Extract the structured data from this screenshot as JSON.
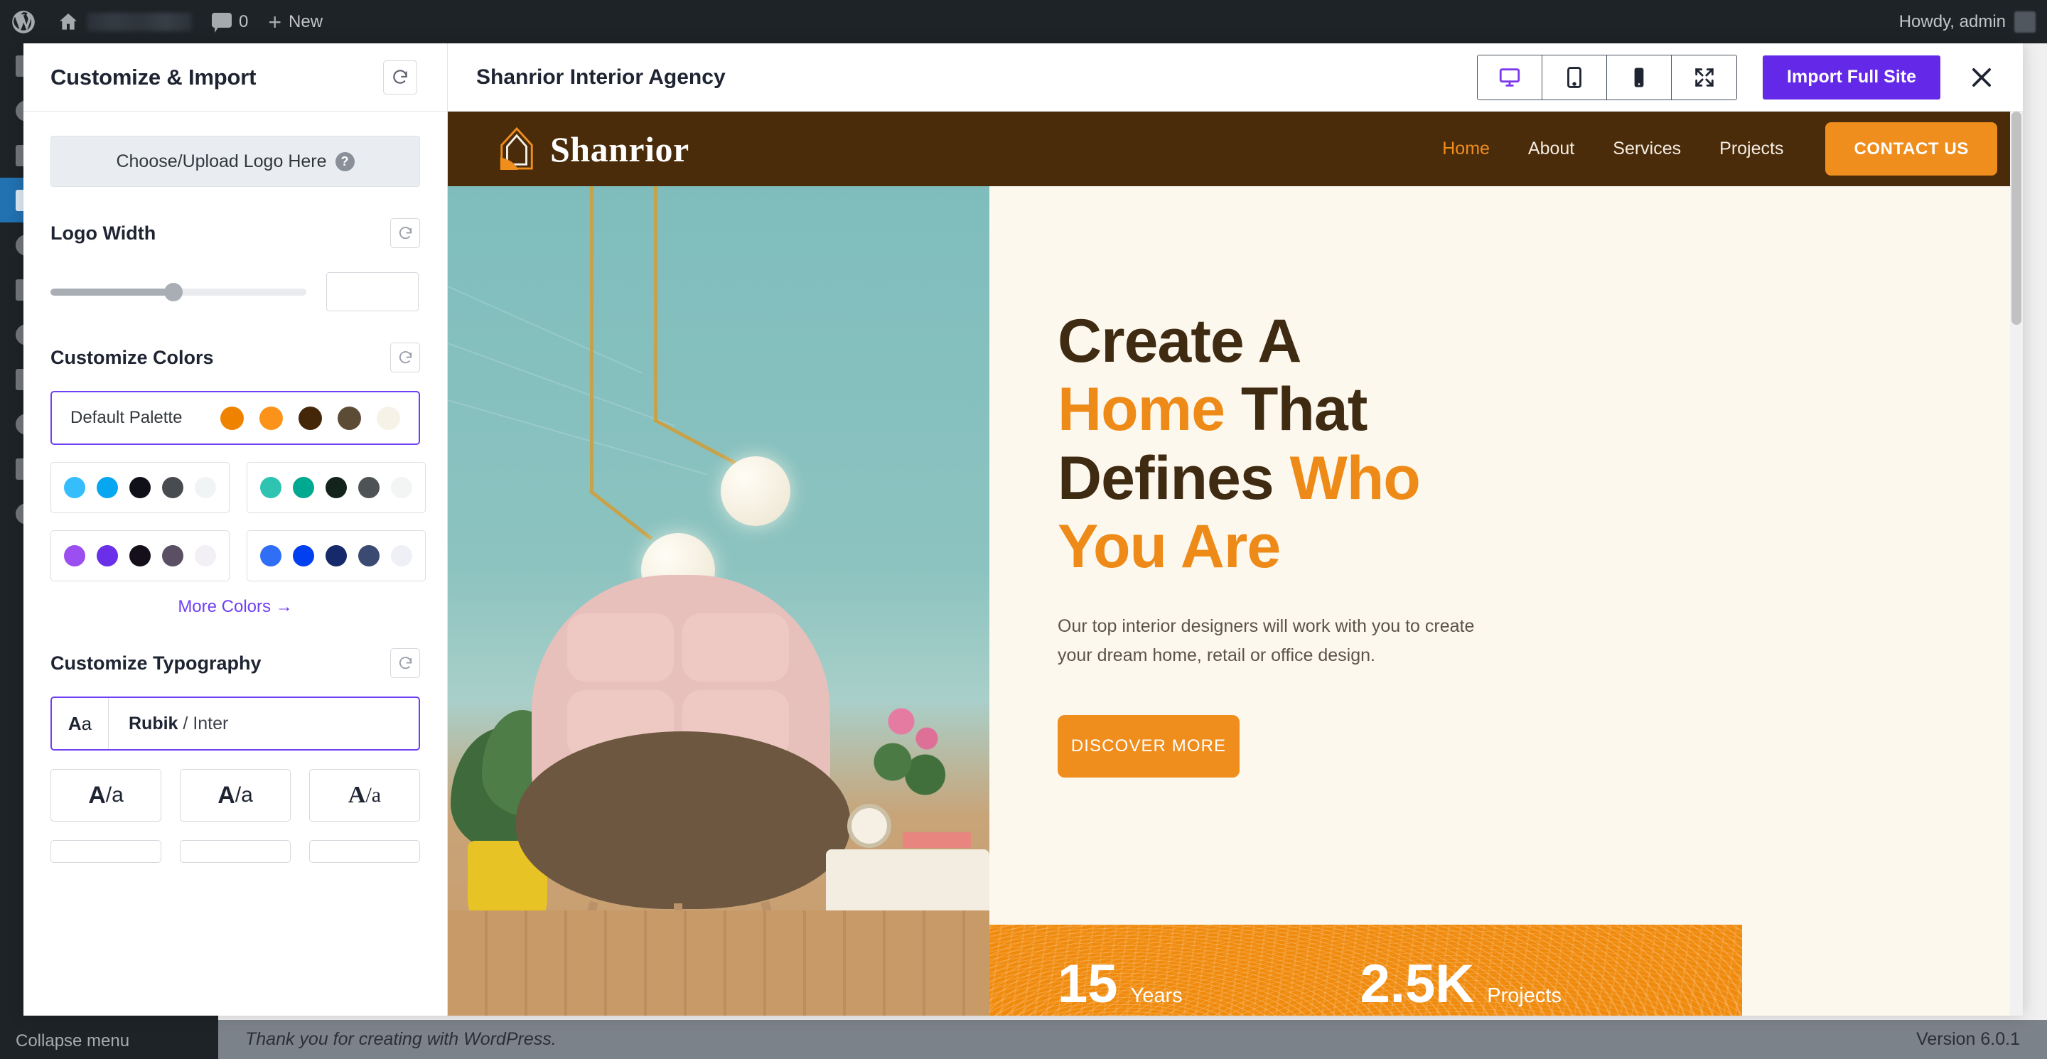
{
  "adminbar": {
    "wp_logo_icon": "wordpress-logo-icon",
    "home_icon": "home-icon",
    "site_name": "",
    "comment_icon": "comment-bubble-icon",
    "comment_count": "0",
    "new_icon": "plus-icon",
    "new_label": "New",
    "howdy": "Howdy, admin",
    "avatar": "avatar"
  },
  "admin_menu": {
    "collapse_label": "Collapse menu"
  },
  "footer": {
    "thanks": "Thank you for creating with WordPress.",
    "version": "Version 6.0.1"
  },
  "panel": {
    "title": "Customize & Import",
    "reset_icon": "reset-icon",
    "logo": {
      "upload_label": "Choose/Upload Logo Here",
      "help_icon": "help-icon",
      "help_glyph": "?"
    },
    "logo_width": {
      "title": "Logo Width",
      "value": "",
      "placeholder": "",
      "percent": 48
    },
    "colors": {
      "title": "Customize Colors",
      "more_label": "More Colors",
      "more_arrow": "→",
      "palettes": [
        {
          "name": "Default Palette",
          "selected": true,
          "swatches": [
            "#ef8300",
            "#fb9219",
            "#432708",
            "#5c4c35",
            "#f7f2e8"
          ]
        },
        {
          "name": "",
          "selected": false,
          "swatches": [
            "#35befb",
            "#07a6f0",
            "#101018",
            "#484c51",
            "#f1f4f5"
          ]
        },
        {
          "name": "",
          "selected": false,
          "swatches": [
            "#2fc4b2",
            "#00a98f",
            "#13241d",
            "#4e5356",
            "#f2f5f3"
          ]
        },
        {
          "name": "",
          "selected": false,
          "swatches": [
            "#9b4ff0",
            "#6a2fe8",
            "#150f1c",
            "#5a4f63",
            "#f2eff5"
          ]
        },
        {
          "name": "",
          "selected": false,
          "swatches": [
            "#2f6ef5",
            "#0040f0",
            "#16296b",
            "#3a4a70",
            "#eef0f5"
          ]
        }
      ]
    },
    "typography": {
      "title": "Customize Typography",
      "sample_caps": "A",
      "sample_lower": "a",
      "selected": {
        "heading_font": "Rubik",
        "separator": "/",
        "body_font": "Inter"
      },
      "tiles": [
        {
          "caps": "A",
          "slash": "/",
          "lower": "a"
        },
        {
          "caps": "A",
          "slash": "/",
          "lower": "a"
        },
        {
          "caps": "A",
          "slash": "/",
          "lower": "a"
        }
      ]
    }
  },
  "preview": {
    "title": "Shanrior Interior Agency",
    "devices": [
      {
        "name": "desktop",
        "icon": "desktop-icon",
        "active": true
      },
      {
        "name": "tablet",
        "icon": "tablet-icon",
        "active": false
      },
      {
        "name": "mobile",
        "icon": "mobile-icon",
        "active": false
      },
      {
        "name": "fullscreen",
        "icon": "expand-icon",
        "active": false
      }
    ],
    "import_label": "Import Full Site",
    "close_icon": "close-icon",
    "accent_color": "#6429e8"
  },
  "site": {
    "brand": {
      "name": "Shanrior",
      "logo_icon": "shanrior-logo-icon"
    },
    "nav": [
      {
        "label": "Home",
        "active": true
      },
      {
        "label": "About",
        "active": false
      },
      {
        "label": "Services",
        "active": false
      },
      {
        "label": "Projects",
        "active": false
      }
    ],
    "cta": "CONTACT US",
    "hero": {
      "line1": "Create A",
      "line2_accent": "Home",
      "line2_rest": "That",
      "line3_rest": "Defines",
      "line3_accent": "Who",
      "line4_accent": "You Are",
      "paragraph": "Our top interior designers will work with you to create your dream home, retail or office design.",
      "button": "DISCOVER MORE"
    },
    "stats": [
      {
        "number": "15",
        "label": "Years"
      },
      {
        "number": "2.5K",
        "label": "Projects"
      }
    ],
    "colors": {
      "header_bg": "#4a2c0a",
      "orange": "#ef8d1d",
      "cream": "#fdf8ee",
      "heading": "#3f2a12"
    }
  }
}
